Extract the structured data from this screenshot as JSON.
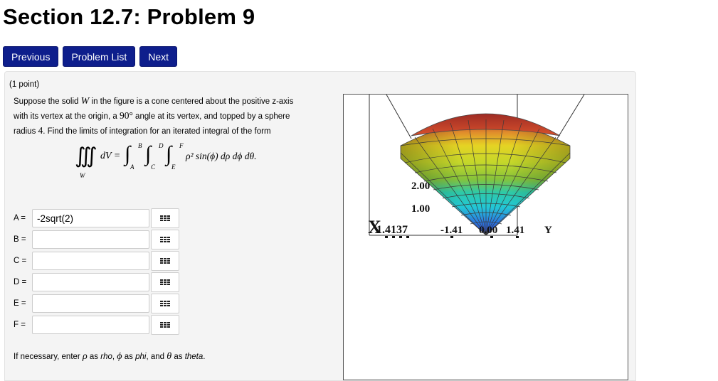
{
  "page": {
    "title": "Section 12.7: Problem 9"
  },
  "nav": {
    "previous": "Previous",
    "problem_list": "Problem List",
    "next": "Next"
  },
  "problem": {
    "points": "(1 point)",
    "text_1": "Suppose the solid",
    "var_W": "W",
    "text_2": "in the figure is a cone centered about the positive z-axis",
    "text_3": "with its vertex at the origin, a",
    "angle": "90°",
    "text_4": "angle at its vertex, and topped by a sphere",
    "text_5": "radius",
    "radius": "4",
    "text_6": ". Find the limits of integration for an iterated integral of the form",
    "formula": {
      "triple_integral": "∭",
      "region": "W",
      "dv": "dV =",
      "integral": "∫",
      "lim_A": "A",
      "lim_B": "B",
      "lim_C": "C",
      "lim_D": "D",
      "lim_E": "E",
      "lim_F": "F",
      "integrand": "ρ² sin(ϕ) dρ dϕ dθ."
    }
  },
  "answers": [
    {
      "label": "A =",
      "value": "-2sqrt(2)",
      "editor_icon": "equation-editor-icon"
    },
    {
      "label": "B =",
      "value": "",
      "editor_icon": "equation-editor-icon"
    },
    {
      "label": "C =",
      "value": "",
      "editor_icon": "equation-editor-icon"
    },
    {
      "label": "D =",
      "value": "",
      "editor_icon": "equation-editor-icon"
    },
    {
      "label": "E =",
      "value": "",
      "editor_icon": "equation-editor-icon"
    },
    {
      "label": "F =",
      "value": "",
      "editor_icon": "equation-editor-icon"
    }
  ],
  "note": {
    "text_1": "If necessary, enter",
    "rho": "ρ",
    "text_2": "as",
    "rho_word": "rho",
    "text_3": ",",
    "phi": "ϕ",
    "text_4": "as",
    "phi_word": "phi",
    "text_5": ", and",
    "theta": "θ",
    "text_6": "as",
    "theta_word": "theta",
    "text_7": "."
  },
  "graph": {
    "tick_200": "2.00",
    "tick_100": "1.00",
    "x_axis_label": "X",
    "tick_neg_141": "-1.41",
    "tick_000": "0.00",
    "tick_141": "1.41",
    "y_axis_label": "Y",
    "overlap_text": "1.4137",
    "colors": {
      "top": "#b5412a",
      "yellow": "#e5d324",
      "green": "#86c33a",
      "cyan": "#22c7d6",
      "blue": "#2a3fd6"
    }
  }
}
